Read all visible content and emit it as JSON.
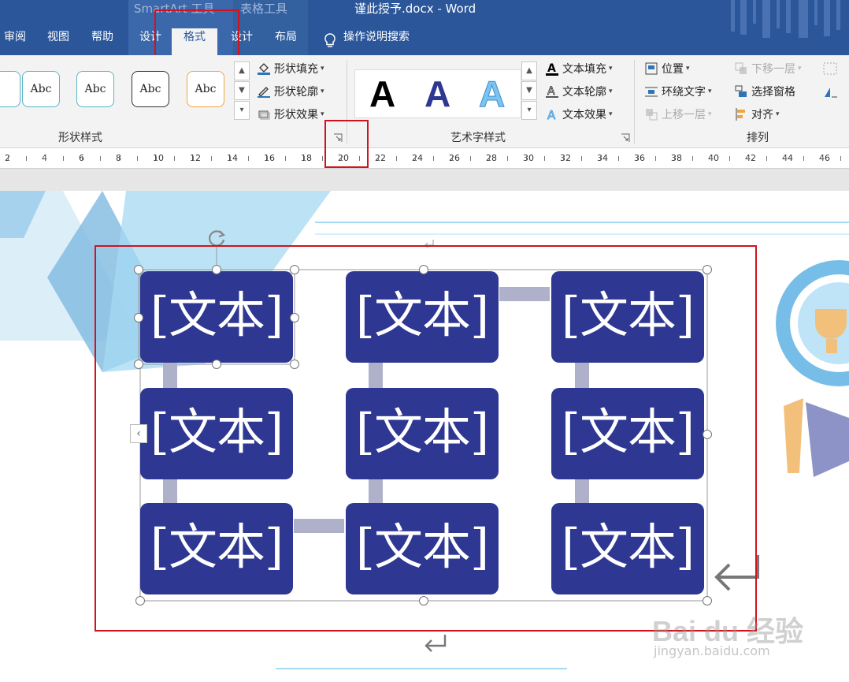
{
  "window": {
    "doc_title": "谨此授予.docx  -  Word",
    "context_groups": [
      "SmartArt 工具",
      "表格工具"
    ]
  },
  "tabs": [
    {
      "label": "审阅"
    },
    {
      "label": "视图"
    },
    {
      "label": "帮助"
    },
    {
      "label": "设计"
    },
    {
      "label": "格式",
      "active": true
    },
    {
      "label": "设计"
    },
    {
      "label": "布局"
    }
  ],
  "tell_me": "操作说明搜索",
  "ribbon": {
    "shape_styles": {
      "gallery": [
        "Abc",
        "Abc",
        "Abc",
        "Abc"
      ],
      "commands": [
        "形状填充",
        "形状轮廓",
        "形状效果"
      ],
      "group_label": "形状样式"
    },
    "wordart_styles": {
      "gallery": [
        "A",
        "A",
        "A"
      ],
      "commands": [
        "文本填充",
        "文本轮廓",
        "文本效果"
      ],
      "group_label": "艺术字样式"
    },
    "arrange": {
      "commands": [
        "位置",
        "环绕文字",
        "上移一层",
        "下移一层",
        "选择窗格",
        "对齐"
      ],
      "group_label": "排列"
    }
  },
  "ruler": {
    "labels": [
      "2",
      "4",
      "6",
      "8",
      "10",
      "12",
      "14",
      "16",
      "18",
      "20",
      "22",
      "24",
      "26",
      "28",
      "30",
      "32",
      "34",
      "36",
      "38",
      "40",
      "42",
      "44",
      "46"
    ]
  },
  "smartart": {
    "placeholder": "[文本]",
    "expand_arrow": "‹"
  },
  "watermark": {
    "logo": "Bai du 经验",
    "url": "jingyan.baidu.com"
  },
  "colors": {
    "title_bar": "#2b579a",
    "box_fill": "#2e3791",
    "connector": "#aeb1c9",
    "highlight": "#d0131e"
  }
}
